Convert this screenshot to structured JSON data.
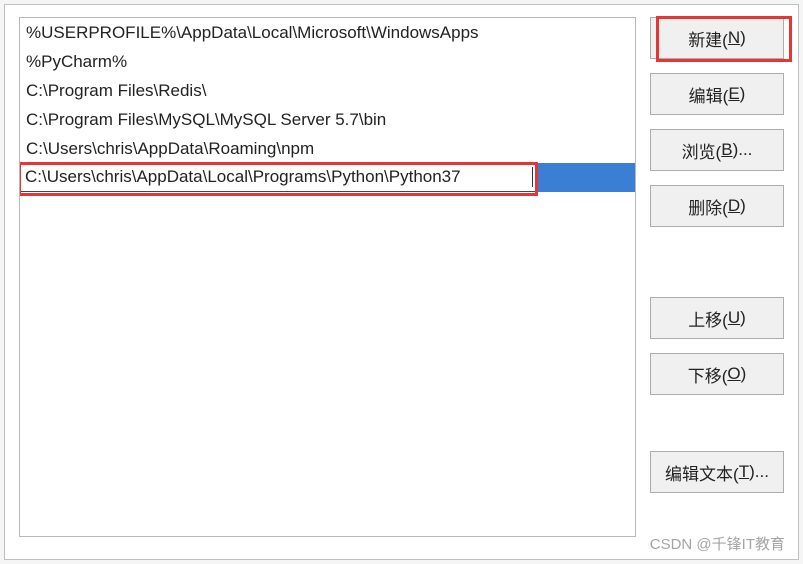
{
  "path_entries": [
    "%USERPROFILE%\\AppData\\Local\\Microsoft\\WindowsApps",
    "%PyCharm%",
    "C:\\Program Files\\Redis\\",
    "C:\\Program Files\\MySQL\\MySQL Server 5.7\\bin",
    "C:\\Users\\chris\\AppData\\Roaming\\npm",
    "C:\\Users\\chris\\AppData\\Local\\Programs\\Python\\Python37"
  ],
  "selected_index": 5,
  "buttons": {
    "new": {
      "label": "新建(",
      "hotkey": "N",
      "suffix": ")"
    },
    "edit": {
      "label": "编辑(",
      "hotkey": "E",
      "suffix": ")"
    },
    "browse": {
      "label": "浏览(",
      "hotkey": "B",
      "suffix": ")..."
    },
    "delete": {
      "label": "删除(",
      "hotkey": "D",
      "suffix": ")"
    },
    "move_up": {
      "label": "上移(",
      "hotkey": "U",
      "suffix": ")"
    },
    "move_down": {
      "label": "下移(",
      "hotkey": "O",
      "suffix": ")"
    },
    "edit_text": {
      "label": "编辑文本(",
      "hotkey": "T",
      "suffix": ")..."
    }
  },
  "watermark": "CSDN @千锋IT教育"
}
